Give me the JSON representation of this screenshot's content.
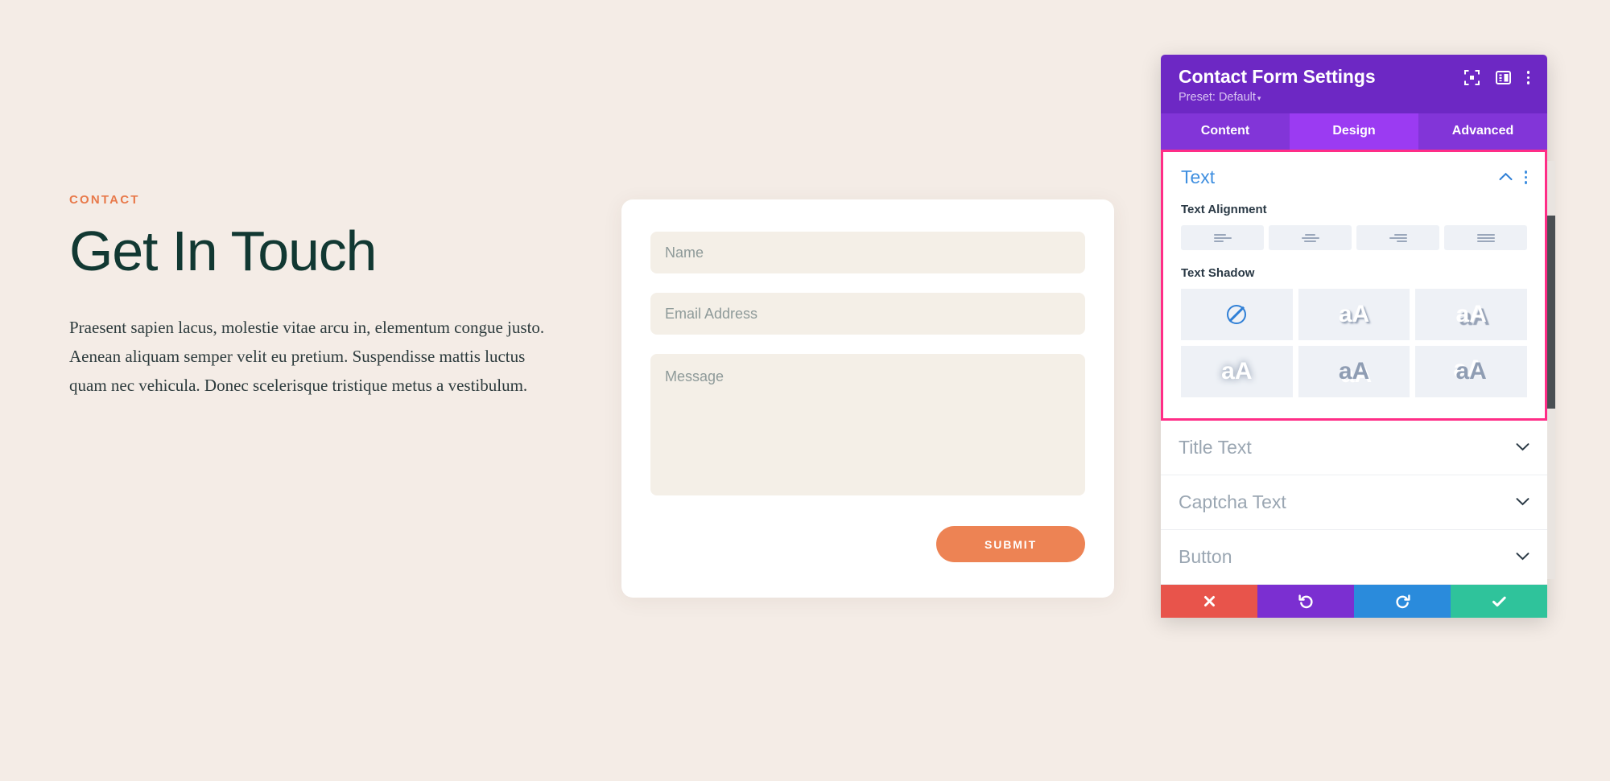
{
  "page": {
    "background_color": "#f4ece6",
    "eyebrow": "CONTACT",
    "eyebrow_color": "#e8794a",
    "headline": "Get In Touch",
    "headline_color": "#113832",
    "body_copy": "Praesent sapien lacus, molestie vitae arcu in, elementum congue justo. Aenean aliquam semper velit eu pretium. Suspendisse mattis luctus quam nec vehicula. Donec scelerisque tristique metus a vestibulum."
  },
  "form": {
    "name_placeholder": "Name",
    "email_placeholder": "Email Address",
    "message_placeholder": "Message",
    "submit_label": "SUBMIT",
    "submit_color": "#ed8354",
    "card_color": "#ffffff",
    "field_color": "#f4efe7"
  },
  "modal": {
    "title": "Contact Form Settings",
    "preset_label": "Preset: Default",
    "preset_caret": "▾",
    "header_color": "#6d28c4",
    "icons": {
      "focus": "focus-target-icon",
      "layout": "panel-layout-icon",
      "menu": "kebab-menu-icon"
    },
    "tabs": [
      {
        "label": "Content",
        "active": false
      },
      {
        "label": "Design",
        "active": true
      },
      {
        "label": "Advanced",
        "active": false
      }
    ],
    "highlight_color": "#ff2d87",
    "open_section": {
      "title": "Text",
      "title_color": "#3f8fe0",
      "collapse_icon": "chevron-up-icon",
      "menu_icon": "kebab-menu-icon",
      "text_alignment": {
        "label": "Text Alignment",
        "options": [
          "align-left",
          "align-center",
          "align-right",
          "align-justify"
        ]
      },
      "text_shadow": {
        "label": "Text Shadow",
        "options": [
          {
            "name": "none",
            "glyph": "",
            "selected": true
          },
          {
            "name": "shadow-soft-down",
            "glyph": "aA",
            "selected": false
          },
          {
            "name": "shadow-hard-down",
            "glyph": "aA",
            "selected": false
          },
          {
            "name": "shadow-glow",
            "glyph": "aA",
            "selected": false
          },
          {
            "name": "shadow-inner-down",
            "glyph": "aA",
            "selected": false
          },
          {
            "name": "shadow-inner-up",
            "glyph": "aA",
            "selected": false
          }
        ]
      }
    },
    "closed_sections": [
      {
        "title": "Title Text",
        "icon": "chevron-down-icon"
      },
      {
        "title": "Captcha Text",
        "icon": "chevron-down-icon"
      },
      {
        "title": "Button",
        "icon": "chevron-down-icon"
      }
    ],
    "actions": [
      {
        "name": "cancel",
        "icon": "close-x-icon",
        "color": "#e8544b"
      },
      {
        "name": "undo",
        "icon": "undo-arrow-icon",
        "color": "#7b2fd1"
      },
      {
        "name": "redo",
        "icon": "redo-arrow-icon",
        "color": "#2a8bdc"
      },
      {
        "name": "save",
        "icon": "checkmark-icon",
        "color": "#2fc39b"
      }
    ]
  }
}
